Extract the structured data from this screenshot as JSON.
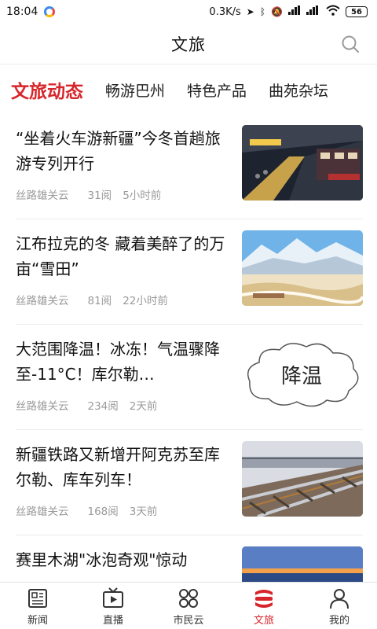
{
  "status_bar": {
    "time": "18:04",
    "network_speed": "0.3K/s",
    "battery": "56"
  },
  "header": {
    "title": "文旅"
  },
  "tabs": [
    {
      "label": "文旅动态",
      "active": true
    },
    {
      "label": "畅游巴州",
      "active": false
    },
    {
      "label": "特色产品",
      "active": false
    },
    {
      "label": "曲苑杂坛",
      "active": false
    }
  ],
  "articles": [
    {
      "title": "“坐着火车游新疆”今冬首趟旅游专列开行",
      "source": "丝路雄关云",
      "views": "31阅",
      "time": "5小时前",
      "thumb": "train-station-photo"
    },
    {
      "title": "江布拉克的冬 藏着美醉了的万亩“雪田”",
      "source": "丝路雄关云",
      "views": "81阅",
      "time": "22小时前",
      "thumb": "snow-field-photo"
    },
    {
      "title": "大范围降温！冰冻！气温骤降至-11°C！库尔勒…",
      "source": "丝路雄关云",
      "views": "234阅",
      "time": "2天前",
      "thumb": "cooling-cloud-graphic",
      "thumb_text": "降温"
    },
    {
      "title": "新疆铁路又新增开阿克苏至库尔勒、库车列车！",
      "source": "丝路雄关云",
      "views": "168阅",
      "time": "3天前",
      "thumb": "railway-track-photo"
    },
    {
      "title": "赛里木湖\"冰泡奇观\"惊动",
      "source": "",
      "views": "",
      "time": "",
      "thumb": "lake-sunset-photo"
    }
  ],
  "bottom_nav": [
    {
      "label": "新闻",
      "icon": "news-icon",
      "active": false
    },
    {
      "label": "直播",
      "icon": "live-tv-icon",
      "active": false
    },
    {
      "label": "市民云",
      "icon": "citizen-cloud-icon",
      "active": false
    },
    {
      "label": "文旅",
      "icon": "culture-travel-icon",
      "active": true
    },
    {
      "label": "我的",
      "icon": "profile-icon",
      "active": false
    }
  ],
  "colors": {
    "accent": "#d7262b",
    "meta_text": "#9a9a9a",
    "divider": "#ececec"
  }
}
